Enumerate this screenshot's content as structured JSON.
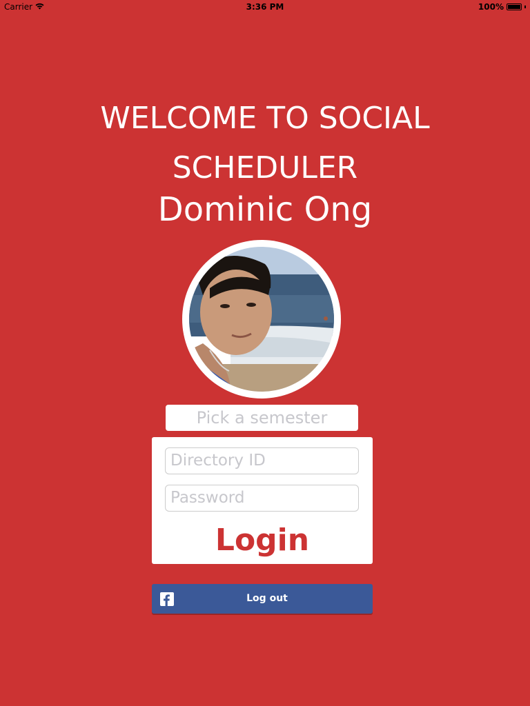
{
  "status_bar": {
    "carrier": "Carrier",
    "time": "3:36 PM",
    "battery": "100%",
    "battery_level": 1.0
  },
  "header": {
    "welcome_line1": "WELCOME TO SOCIAL",
    "welcome_line2": "SCHEDULER",
    "user_name": "Dominic Ong"
  },
  "semester_picker": {
    "placeholder": "Pick a semester"
  },
  "login_form": {
    "directory_id_placeholder": "Directory ID",
    "password_placeholder": "Password",
    "login_label": "Login"
  },
  "facebook": {
    "logout_label": "Log out"
  },
  "colors": {
    "background": "#cc3333",
    "accent": "#cc3333",
    "facebook_blue": "#3b5998",
    "placeholder": "#c7c7cc"
  }
}
